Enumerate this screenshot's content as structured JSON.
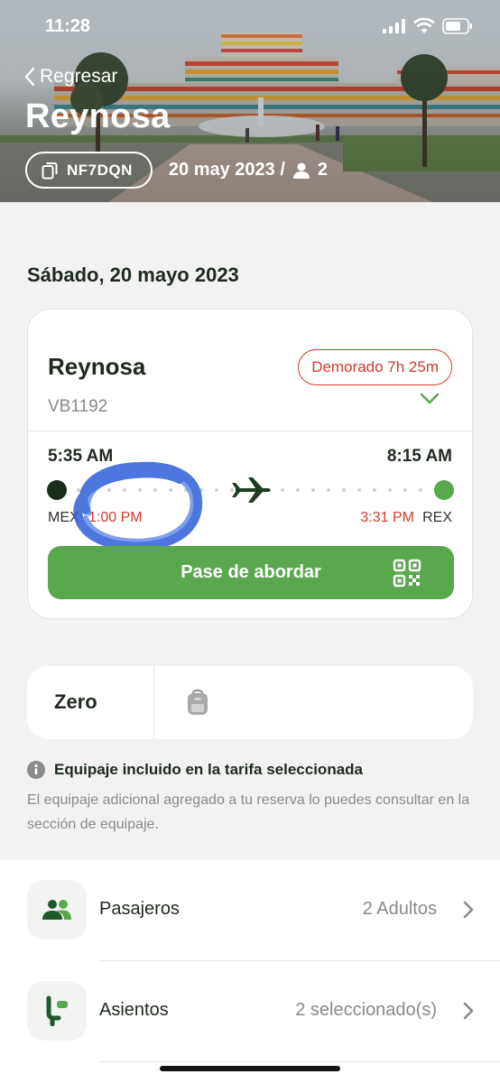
{
  "status_bar": {
    "time": "11:28"
  },
  "header": {
    "back_label": "Regresar",
    "city": "Reynosa",
    "pnr": "NF7DQN",
    "date_short": "20 may 2023 /",
    "passenger_count": "2"
  },
  "date_heading": "Sábado, 20 mayo 2023",
  "flight": {
    "destination": "Reynosa",
    "flight_number": "VB1192",
    "status": "Demorado 7h 25m",
    "departure_time": "5:35 AM",
    "arrival_time": "8:15 AM",
    "origin_code": "MEX",
    "new_departure_time": "1:00 PM",
    "new_arrival_time": "3:31 PM",
    "destination_code": "REX",
    "boarding_button": "Pase de abordar"
  },
  "fare": {
    "name": "Zero"
  },
  "baggage": {
    "title": "Equipaje incluido en la tarifa seleccionada",
    "text": "El equipaje adicional agregado a tu reserva lo puedes consultar en la sección de equipaje."
  },
  "rows": [
    {
      "label": "Pasajeros",
      "value": "2 Adultos"
    },
    {
      "label": "Asientos",
      "value": "2 seleccionado(s)"
    }
  ],
  "colors": {
    "brand_green": "#5aa84e",
    "dark_green": "#1f3d22",
    "delay_red": "#cf3b2c",
    "annotation_blue": "#2f5fd8"
  }
}
